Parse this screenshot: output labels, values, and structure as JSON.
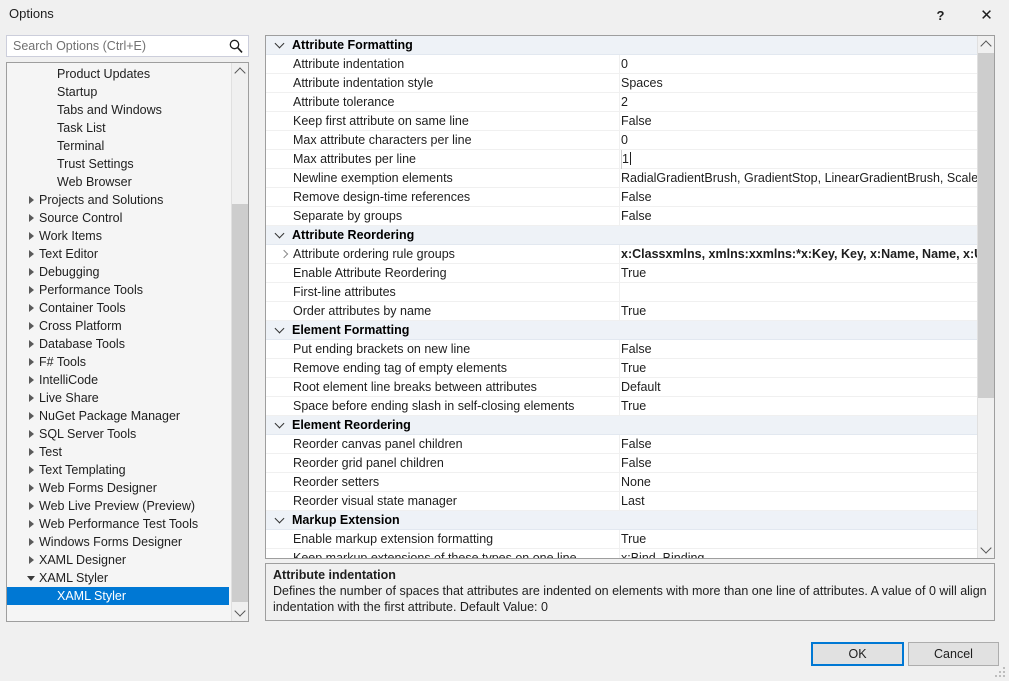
{
  "window": {
    "title": "Options",
    "help_label": "?",
    "close_label": "✕"
  },
  "search": {
    "placeholder": "Search Options (Ctrl+E)",
    "value": "",
    "icon": "search-icon"
  },
  "tree": {
    "items": [
      {
        "label": "Product Updates",
        "level": 1,
        "expander": "none",
        "selected": false
      },
      {
        "label": "Startup",
        "level": 1,
        "expander": "none",
        "selected": false
      },
      {
        "label": "Tabs and Windows",
        "level": 1,
        "expander": "none",
        "selected": false
      },
      {
        "label": "Task List",
        "level": 1,
        "expander": "none",
        "selected": false
      },
      {
        "label": "Terminal",
        "level": 1,
        "expander": "none",
        "selected": false
      },
      {
        "label": "Trust Settings",
        "level": 1,
        "expander": "none",
        "selected": false
      },
      {
        "label": "Web Browser",
        "level": 1,
        "expander": "none",
        "selected": false
      },
      {
        "label": "Projects and Solutions",
        "level": 0,
        "expander": "collapsed",
        "selected": false
      },
      {
        "label": "Source Control",
        "level": 0,
        "expander": "collapsed",
        "selected": false
      },
      {
        "label": "Work Items",
        "level": 0,
        "expander": "collapsed",
        "selected": false
      },
      {
        "label": "Text Editor",
        "level": 0,
        "expander": "collapsed",
        "selected": false
      },
      {
        "label": "Debugging",
        "level": 0,
        "expander": "collapsed",
        "selected": false
      },
      {
        "label": "Performance Tools",
        "level": 0,
        "expander": "collapsed",
        "selected": false
      },
      {
        "label": "Container Tools",
        "level": 0,
        "expander": "collapsed",
        "selected": false
      },
      {
        "label": "Cross Platform",
        "level": 0,
        "expander": "collapsed",
        "selected": false
      },
      {
        "label": "Database Tools",
        "level": 0,
        "expander": "collapsed",
        "selected": false
      },
      {
        "label": "F# Tools",
        "level": 0,
        "expander": "collapsed",
        "selected": false
      },
      {
        "label": "IntelliCode",
        "level": 0,
        "expander": "collapsed",
        "selected": false
      },
      {
        "label": "Live Share",
        "level": 0,
        "expander": "collapsed",
        "selected": false
      },
      {
        "label": "NuGet Package Manager",
        "level": 0,
        "expander": "collapsed",
        "selected": false
      },
      {
        "label": "SQL Server Tools",
        "level": 0,
        "expander": "collapsed",
        "selected": false
      },
      {
        "label": "Test",
        "level": 0,
        "expander": "collapsed",
        "selected": false
      },
      {
        "label": "Text Templating",
        "level": 0,
        "expander": "collapsed",
        "selected": false
      },
      {
        "label": "Web Forms Designer",
        "level": 0,
        "expander": "collapsed",
        "selected": false
      },
      {
        "label": "Web Live Preview (Preview)",
        "level": 0,
        "expander": "collapsed",
        "selected": false
      },
      {
        "label": "Web Performance Test Tools",
        "level": 0,
        "expander": "collapsed",
        "selected": false
      },
      {
        "label": "Windows Forms Designer",
        "level": 0,
        "expander": "collapsed",
        "selected": false
      },
      {
        "label": "XAML Designer",
        "level": 0,
        "expander": "collapsed",
        "selected": false
      },
      {
        "label": "XAML Styler",
        "level": 0,
        "expander": "expanded",
        "selected": false
      },
      {
        "label": "XAML Styler",
        "level": 1,
        "expander": "none",
        "selected": true
      }
    ]
  },
  "grid": {
    "rows": [
      {
        "kind": "category",
        "name": "Attribute Formatting",
        "expander": "expanded"
      },
      {
        "kind": "property",
        "name": "Attribute indentation",
        "value": "0"
      },
      {
        "kind": "property",
        "name": "Attribute indentation style",
        "value": "Spaces"
      },
      {
        "kind": "property",
        "name": "Attribute tolerance",
        "value": "2"
      },
      {
        "kind": "property",
        "name": "Keep first attribute on same line",
        "value": "False"
      },
      {
        "kind": "property",
        "name": "Max attribute characters per line",
        "value": "0"
      },
      {
        "kind": "property",
        "name": "Max attributes per line",
        "value": "1",
        "editing": true
      },
      {
        "kind": "property",
        "name": "Newline exemption elements",
        "value": "RadialGradientBrush, GradientStop, LinearGradientBrush, ScaleTransform"
      },
      {
        "kind": "property",
        "name": "Remove design-time references",
        "value": "False"
      },
      {
        "kind": "property",
        "name": "Separate by groups",
        "value": "False"
      },
      {
        "kind": "category",
        "name": "Attribute Reordering",
        "expander": "expanded"
      },
      {
        "kind": "property",
        "name": "Attribute ordering rule groups",
        "value": "x:Classxmlns, xmlns:xxmlns:*x:Key, Key, x:Name, Name, x:Uid",
        "bold": true,
        "expander": "collapsed"
      },
      {
        "kind": "property",
        "name": "Enable Attribute Reordering",
        "value": "True"
      },
      {
        "kind": "property",
        "name": "First-line attributes",
        "value": ""
      },
      {
        "kind": "property",
        "name": "Order attributes by name",
        "value": "True"
      },
      {
        "kind": "category",
        "name": "Element Formatting",
        "expander": "expanded"
      },
      {
        "kind": "property",
        "name": "Put ending brackets on new line",
        "value": "False"
      },
      {
        "kind": "property",
        "name": "Remove ending tag of empty elements",
        "value": "True"
      },
      {
        "kind": "property",
        "name": "Root element line breaks between attributes",
        "value": "Default"
      },
      {
        "kind": "property",
        "name": "Space before ending slash in self-closing elements",
        "value": "True"
      },
      {
        "kind": "category",
        "name": "Element Reordering",
        "expander": "expanded"
      },
      {
        "kind": "property",
        "name": "Reorder canvas panel children",
        "value": "False"
      },
      {
        "kind": "property",
        "name": "Reorder grid panel children",
        "value": "False"
      },
      {
        "kind": "property",
        "name": "Reorder setters",
        "value": "None"
      },
      {
        "kind": "property",
        "name": "Reorder visual state manager",
        "value": "Last"
      },
      {
        "kind": "category",
        "name": "Markup Extension",
        "expander": "expanded"
      },
      {
        "kind": "property",
        "name": "Enable markup extension formatting",
        "value": "True"
      },
      {
        "kind": "property",
        "name": "Keep markup extensions of these types on one line",
        "value": "x:Bind, Binding"
      }
    ]
  },
  "description": {
    "title": "Attribute indentation",
    "body": "Defines the number of spaces that attributes are indented on elements with more than one line of attributes. A value of 0 will align indentation with the first attribute. Default Value: 0"
  },
  "footer": {
    "ok_label": "OK",
    "cancel_label": "Cancel"
  },
  "colors": {
    "accent": "#0078d4",
    "selection": "#0078d4",
    "category_row": "#eef2f7",
    "dialog_background": "#f0f0f0",
    "scrollbar_thumb": "#cdcdcd"
  }
}
